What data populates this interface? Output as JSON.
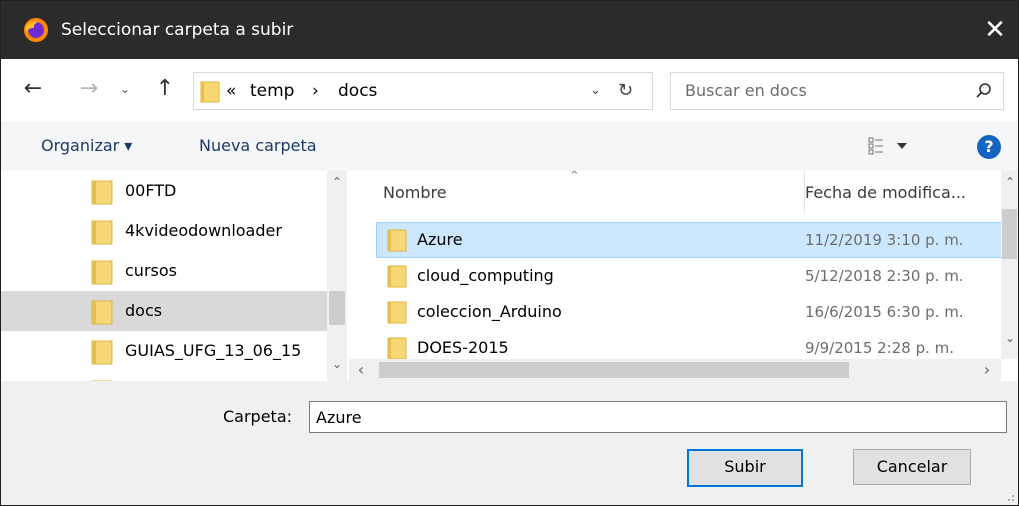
{
  "window": {
    "title": "Seleccionar carpeta a subir",
    "close_glyph": "✕"
  },
  "nav": {
    "back_glyph": "←",
    "forward_glyph": "→",
    "recent_glyph": "⌄",
    "up_glyph": "↑"
  },
  "address": {
    "overflow_glyph": "«",
    "segments": [
      "temp",
      "docs"
    ],
    "separator_glyph": "›",
    "dropdown_glyph": "⌄",
    "refresh_glyph": "↻"
  },
  "search": {
    "placeholder": "Buscar en docs"
  },
  "toolbar": {
    "organize_label": "Organizar ▾",
    "new_folder_label": "Nueva carpeta",
    "help_label": "?"
  },
  "navpane": {
    "items": [
      {
        "label": "00FTD"
      },
      {
        "label": "4kvideodownloader"
      },
      {
        "label": "cursos"
      },
      {
        "label": "docs",
        "selected": true
      },
      {
        "label": "GUIAS_UFG_13_06_15"
      }
    ],
    "scroll_up_glyph": "⌃",
    "scroll_down_glyph": "⌄"
  },
  "filelist": {
    "columns": {
      "name": "Nombre",
      "date": "Fecha de modifica..."
    },
    "sort_glyph": "⌃",
    "rows": [
      {
        "name": "Azure",
        "date": "11/2/2019 3:10 p. m.",
        "selected": true
      },
      {
        "name": "cloud_computing",
        "date": "5/12/2018 2:30 p. m."
      },
      {
        "name": "coleccion_Arduino",
        "date": "16/6/2015 6:30 p. m."
      },
      {
        "name": "DOES-2015",
        "date": "9/9/2015 2:28 p. m."
      }
    ],
    "scroll_left_glyph": "‹",
    "scroll_right_glyph": "›",
    "scroll_up_glyph": "⌃",
    "scroll_down_glyph": "⌄"
  },
  "footer": {
    "folder_label": "Carpeta:",
    "folder_value": "Azure",
    "submit_label": "Subir",
    "cancel_label": "Cancelar"
  },
  "colors": {
    "titlebar": "#2b2b2b",
    "selection": "#cce8ff",
    "nav_selection": "#d9d9d9",
    "folder_yellow": "#f8d775",
    "accent": "#0078d7"
  }
}
